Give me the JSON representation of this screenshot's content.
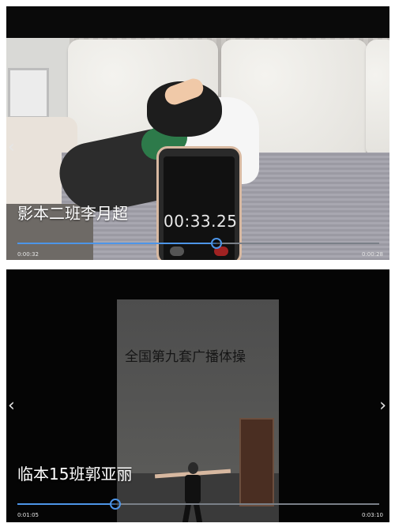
{
  "videos": [
    {
      "title": "影本二班李月超",
      "stopwatch_time": "00:33.25",
      "elapsed": "0:00:32",
      "duration": "0:00:28",
      "progress": 0.55
    },
    {
      "title": "临本15班郭亚丽",
      "caption": "全国第九套广播体操",
      "elapsed": "0:01:05",
      "duration": "0:03:10",
      "progress": 0.27
    }
  ],
  "icons": {
    "prev": "chevron-left-icon",
    "next": "chevron-right-icon",
    "prev_glyph": "‹",
    "next_glyph": "›"
  },
  "colors": {
    "progress_fill": "#4d95e8",
    "progress_track": "#7a8088",
    "overlay_text": "#ffffff"
  }
}
